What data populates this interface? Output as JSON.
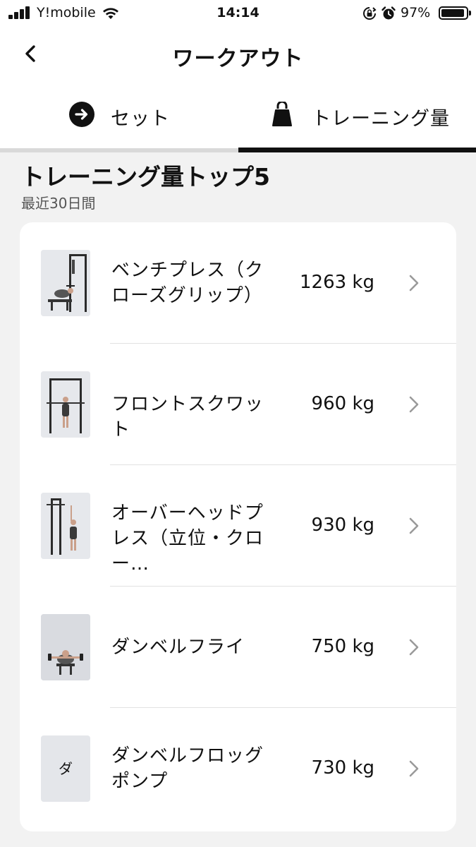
{
  "status_bar": {
    "carrier": "Y!mobile",
    "time": "14:14",
    "battery_pct": "97%",
    "icons": [
      "signal-icon",
      "wifi-icon",
      "orientation-lock-icon",
      "alarm-icon",
      "battery-icon"
    ]
  },
  "nav": {
    "title": "ワークアウト",
    "back_icon": "chevron-left-icon"
  },
  "tabs": [
    {
      "label": "セット",
      "icon": "arrow-right-circle-icon",
      "selected": false
    },
    {
      "label": "トレーニング量",
      "icon": "kettlebell-icon",
      "selected": true
    }
  ],
  "section": {
    "title": "トレーニング量トップ5",
    "subtitle": "最近30日間"
  },
  "exercises": [
    {
      "name": "ベンチプレス（クローズグリップ）",
      "value": "1263 kg",
      "thumb": "bench-press-image"
    },
    {
      "name": "フロントスクワット",
      "value": "960 kg",
      "thumb": "front-squat-image"
    },
    {
      "name": "オーバーヘッドプレス（立位・クロー…",
      "value": "930 kg",
      "thumb": "overhead-press-image"
    },
    {
      "name": "ダンベルフライ",
      "value": "750 kg",
      "thumb": "dumbbell-fly-image"
    },
    {
      "name": "ダンベルフロッグポンプ",
      "value": "730 kg",
      "thumb_text": "ダ"
    }
  ],
  "colors": {
    "background": "#f2f2f2",
    "card": "#ffffff",
    "text": "#111111",
    "muted": "#555555",
    "chevron": "#9a9a9a",
    "tab_track": "#d9d9d9"
  }
}
